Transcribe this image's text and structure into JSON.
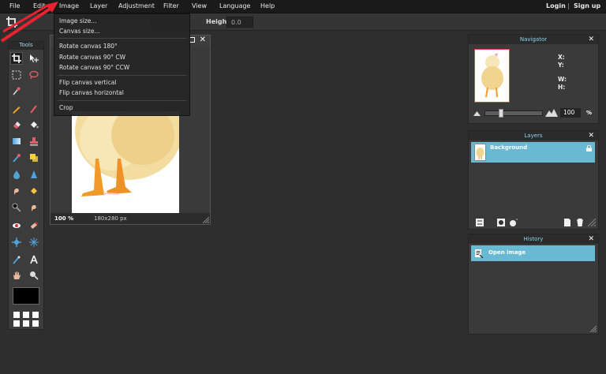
{
  "menu": {
    "file": "File",
    "edit": "Edit",
    "image": "Image",
    "layer": "Layer",
    "adjustment": "Adjustment",
    "filter": "Filter",
    "view": "View",
    "language": "Language",
    "help": "Help",
    "login": "Login",
    "separator": "|",
    "signup": "Sign up"
  },
  "options": {
    "height_label": "Height:",
    "height_value": "0.0"
  },
  "image_menu": {
    "items": [
      "Image size...",
      "Canvas size...",
      "Rotate canvas 180°",
      "Rotate canvas 90° CW",
      "Rotate canvas 90° CCW",
      "Flip canvas vertical",
      "Flip canvas horizontal",
      "Crop"
    ]
  },
  "tools_panel": {
    "title": "Tools"
  },
  "image_window": {
    "zoom": "100",
    "zoom_unit": "%",
    "dimensions": "180x280 px"
  },
  "navigator": {
    "title": "Navigator",
    "x_label": "X:",
    "y_label": "Y:",
    "w_label": "W:",
    "h_label": "H:",
    "zoom": "100",
    "zoom_unit": "%"
  },
  "layers": {
    "title": "Layers",
    "items": [
      "Background"
    ]
  },
  "history": {
    "title": "History",
    "items": [
      "Open image"
    ]
  },
  "colors": {
    "accent": "#6ab9d3",
    "panel_title": "#8fd2ea",
    "annotation_red": "#e8232f"
  }
}
